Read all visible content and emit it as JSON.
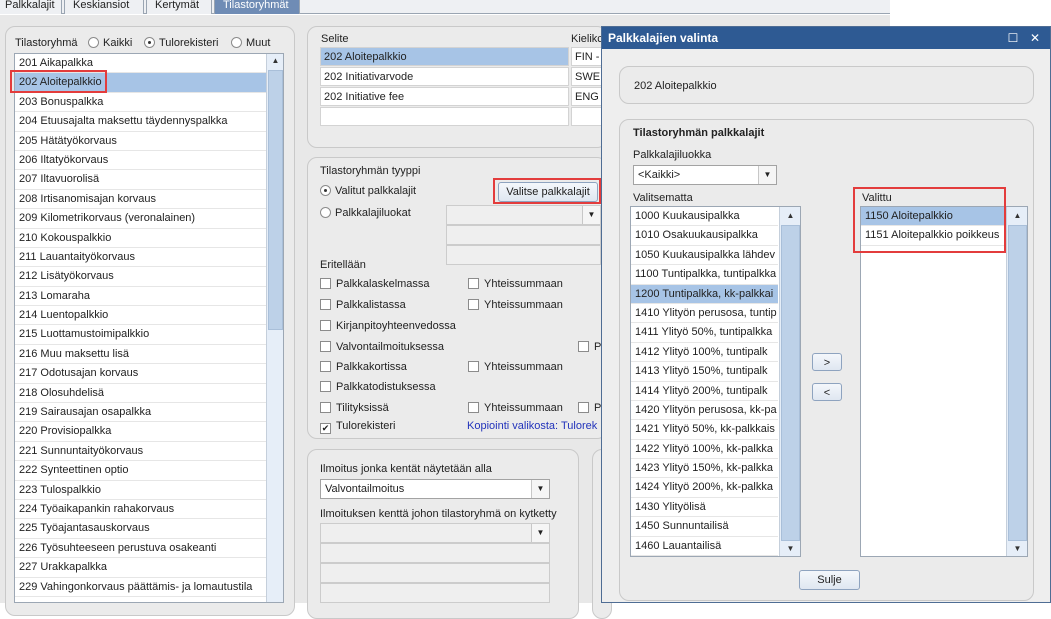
{
  "tabs": [
    "Palkkalajit",
    "Keskiansiot",
    "Kertymät",
    "Tilastoryhmät"
  ],
  "filter": {
    "label": "Tilastoryhmä",
    "options": [
      "Kaikki",
      "Tulorekisteri",
      "Muut"
    ],
    "selected": "Tulorekisteri"
  },
  "groups": [
    "201 Aikapalkka",
    "202 Aloitepalkkio",
    "203 Bonuspalkka",
    "204 Etuusajalta maksettu täydennyspalkka",
    "205 Hätätyökorvaus",
    "206 Iltatyökorvaus",
    "207 Iltavuorolisä",
    "208 Irtisanomisajan korvaus",
    "209 Kilometrikorvaus (veronalainen)",
    "210 Kokouspalkkio",
    "211 Lauantaityökorvaus",
    "212 Lisätyökorvaus",
    "213 Lomaraha",
    "214 Luentopalkkio",
    "215 Luottamustoimipalkkio",
    "216 Muu maksettu lisä",
    "217 Odotusajan korvaus",
    "218 Olosuhdelisä",
    "219 Sairausajan osapalkka",
    "220 Provisiopalkka",
    "221 Sunnuntaityökorvaus",
    "222 Synteettinen optio",
    "223 Tulospalkkio",
    "224 Työaikapankin rahakorvaus",
    "225 Työajantasauskorvaus",
    "226 Työsuhteeseen perustuva osakeanti",
    "227 Urakkapalkka",
    "229 Vahingonkorvaus päättämis- ja lomautustila"
  ],
  "selected_group": "202 Aloitepalkkio",
  "selite": {
    "header": "Selite",
    "kieli_header": "Kielikc",
    "rows": [
      {
        "text": "202 Aloitepalkkio",
        "lang": "FIN -"
      },
      {
        "text": "202 Initiativarvode",
        "lang": "SWE"
      },
      {
        "text": "202 Initiative fee",
        "lang": "ENG"
      }
    ]
  },
  "tyyppi": {
    "title": "Tilastoryhmän tyyppi",
    "opt1": "Valitut palkkalajit",
    "opt2": "Palkkalajiluokat",
    "choose_button": "Valitse palkkalajit"
  },
  "eritellaan": {
    "title": "Eritellään",
    "items": [
      "Palkkalaskelmassa",
      "Palkkalistassa",
      "Kirjanpitoyhteenvedossa",
      "Valvontailmoituksessa",
      "Palkkakortissa",
      "Palkkatodistuksessa",
      "Tilityksissä",
      "Tulorekisteri"
    ],
    "yht": "Yhteissummaan",
    "p": "P",
    "copy_text": "Kopiointi valikosta: Tulorek"
  },
  "ilmoitus": {
    "label1": "Ilmoitus jonka kentät näytetään alla",
    "value1": "Valvontailmoitus",
    "label2": "Ilmoituksen kenttä johon tilastoryhmä on kytketty"
  },
  "dialog": {
    "title": "Palkkalajien valinta",
    "name": "202 Aloitepalkkio",
    "section": "Tilastoryhmän palkkalajit",
    "class_label": "Palkkalajiluokka",
    "class_value": "<Kaikki>",
    "left_label": "Valitsematta",
    "right_label": "Valittu",
    "left_items": [
      "1000 Kuukausipalkka",
      "1010 Osakuukausipalkka",
      "1050 Kuukausipalkka lähdev",
      "1100 Tuntipalkka, tuntipalkka",
      "1200 Tuntipalkka, kk-palkkai",
      "1410 Ylityön perusosa, tuntip",
      "1411 Ylityö 50%, tuntipalkka",
      "1412 Ylityö 100%, tuntipalk",
      "1413 Ylityö 150%, tuntipalk",
      "1414 Ylityö 200%, tuntipalk",
      "1420 Ylityön perusosa, kk-pa",
      "1421 Ylityö 50%, kk-palkkais",
      "1422 Ylityö 100%, kk-palkka",
      "1423 Ylityö 150%, kk-palkka",
      "1424 Ylityö 200%, kk-palkka",
      "1430 Ylityölisä",
      "1450 Sunnuntailisä",
      "1460 Lauantailisä"
    ],
    "left_selected": "1200 Tuntipalkka, kk-palkkai",
    "right_items": [
      "1150 Aloitepalkkio",
      "1151 Aloitepalkkio poikkeus"
    ],
    "right_selected": "1150 Aloitepalkkio",
    "add_btn": ">",
    "remove_btn": "<",
    "close_btn": "Sulje"
  }
}
